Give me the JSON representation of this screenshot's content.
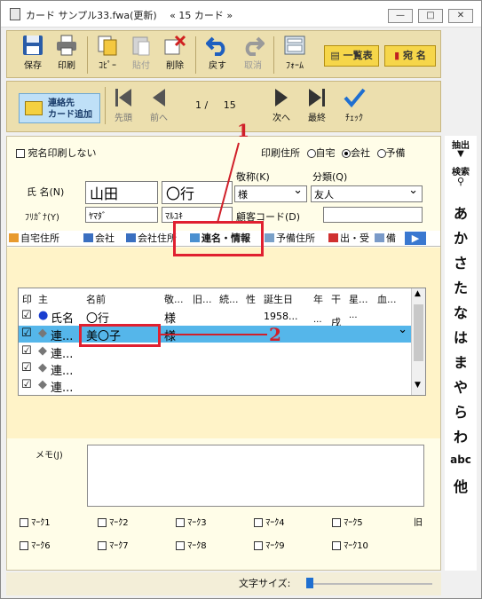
{
  "window": {
    "title": "カード サンプル33.fwa(更新) 　« 15 カード »"
  },
  "toolbar1": {
    "save": "保存",
    "print": "印刷",
    "copy": "ｺﾋﾟｰ",
    "paste": "貼付",
    "delete": "削除",
    "undo": "戻す",
    "cancel": "取消",
    "form": "ﾌｫｰﾑ",
    "list_view": "一覧表",
    "address": "宛 名"
  },
  "toolbar2": {
    "add_contact_line1": "連絡先",
    "add_contact_line2": "カード追加",
    "first": "先頭",
    "prev": "前へ",
    "page_current": "1",
    "page_sep": "/",
    "page_total": "15",
    "next": "次へ",
    "last": "最終",
    "check": "ﾁｪｯｸ"
  },
  "form": {
    "no_print_label": "宛名印刷しない",
    "print_address_label": "印刷住所",
    "opt_home": "自宅",
    "opt_company": "会社",
    "opt_spare": "予備",
    "honorific_label": "敬称(K)",
    "category_label": "分類(Q)",
    "name_label": "氏 名(N)",
    "last_name": "山田",
    "first_name": "〇行",
    "honorific_value": "様",
    "category_value": "友人",
    "kana_label": "ﾌﾘｶﾞﾅ(Y)",
    "kana_last": "ﾔﾏﾀﾞ",
    "kana_first": "ﾏﾙﾕｷ",
    "customer_code_label": "顧客コード(D)",
    "customer_code_value": ""
  },
  "tabs": [
    "自宅住所",
    "会社",
    "会社住所",
    "連名・情報",
    "予備住所",
    "出・受",
    "備"
  ],
  "grid": {
    "headers": [
      "印",
      "主",
      "名前",
      "敬...",
      "旧...",
      "続...",
      "性",
      "誕生日",
      "年",
      "干",
      "星...",
      "血..."
    ],
    "rows": [
      {
        "check": "☑",
        "main": "氏名",
        "name": "〇行",
        "honorific": "様",
        "birthday": "1958...",
        "year": "...",
        "eto": "戌",
        "star": "..."
      },
      {
        "check": "☑",
        "main": "連...",
        "name": "美〇子",
        "honorific": "様"
      },
      {
        "check": "☑",
        "main": "連...",
        "name": ""
      },
      {
        "check": "☑",
        "main": "連...",
        "name": ""
      },
      {
        "check": "☑",
        "main": "連...",
        "name": ""
      }
    ]
  },
  "memo": {
    "label": "メモ(J)",
    "value": ""
  },
  "marks": [
    "ﾏｰｸ1",
    "ﾏｰｸ2",
    "ﾏｰｸ3",
    "ﾏｰｸ4",
    "ﾏｰｸ5",
    "ﾏｰｸ6",
    "ﾏｰｸ7",
    "ﾏｰｸ8",
    "ﾏｰｸ9",
    "ﾏｰｸ10"
  ],
  "mark_extra": "旧",
  "footer": {
    "font_size_label": "文字サイズ:"
  },
  "sidebar": {
    "extract": "抽出",
    "search": "検索",
    "index": [
      "あ",
      "か",
      "さ",
      "た",
      "な",
      "は",
      "ま",
      "や",
      "ら",
      "わ",
      "abc",
      "他"
    ]
  },
  "annotations": {
    "one": "1",
    "two": "2"
  },
  "colors": {
    "toolbar": "#ecdfae",
    "selected_row": "#55b6ea",
    "highlight_red": "#e02030"
  }
}
